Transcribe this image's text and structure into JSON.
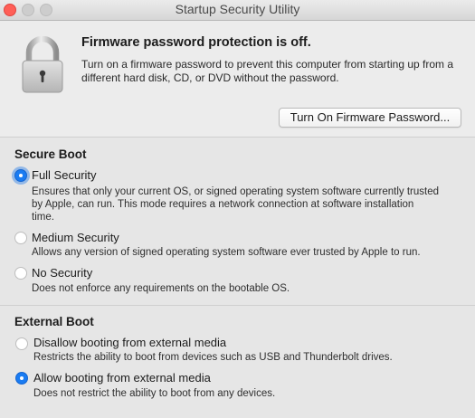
{
  "window": {
    "title": "Startup Security Utility"
  },
  "firmware": {
    "heading": "Firmware password protection is off.",
    "description": "Turn on a firmware password to prevent this computer from starting up from a different hard disk, CD, or DVD without the password.",
    "button_label": "Turn On Firmware Password...",
    "icon": "padlock-icon"
  },
  "secure_boot": {
    "title": "Secure Boot",
    "options": [
      {
        "label": "Full Security",
        "description": "Ensures that only your current OS, or signed operating system software currently trusted by Apple, can run. This mode requires a network connection at software installation time.",
        "selected": true
      },
      {
        "label": "Medium Security",
        "description": "Allows any version of signed operating system software ever trusted by Apple to run.",
        "selected": false
      },
      {
        "label": "No Security",
        "description": "Does not enforce any requirements on the bootable OS.",
        "selected": false
      }
    ]
  },
  "external_boot": {
    "title": "External Boot",
    "options": [
      {
        "label": "Disallow booting from external media",
        "description": "Restricts the ability to boot from devices such as USB and Thunderbolt drives.",
        "selected": false
      },
      {
        "label": "Allow booting from external media",
        "description": "Does not restrict the ability to boot from any devices.",
        "selected": true
      }
    ]
  },
  "colors": {
    "accent": "#1a7cf2",
    "close_button": "#ff5f57"
  }
}
